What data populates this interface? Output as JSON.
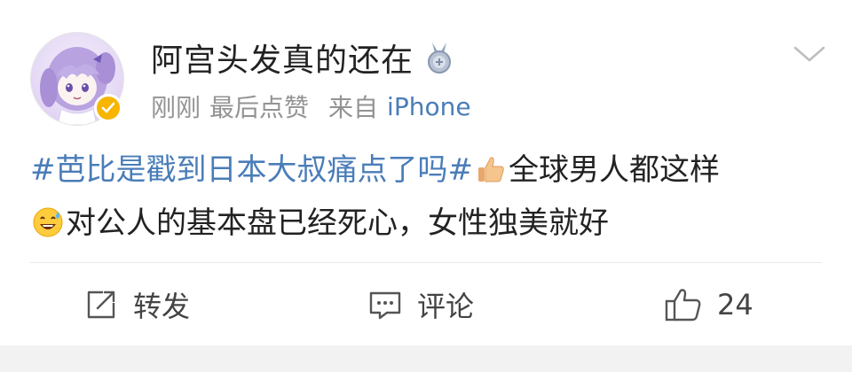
{
  "post": {
    "username": "阿宫头发真的还在",
    "level_badge_icon": "medal-icon",
    "timestamp": "刚刚",
    "activity": "最后点赞",
    "source_prefix": "来自",
    "device": "iPhone",
    "hashtag": "#芭比是戳到日本大叔痛点了吗#",
    "text_part1": "全球男人都这样",
    "text_part2": "对公人的基本盘已经死心，女性独美就好",
    "emoji_1": "thumbs-up-emoji",
    "emoji_2": "sweat-smile-emoji"
  },
  "actions": {
    "repost_label": "转发",
    "comment_label": "评论",
    "like_count": "24"
  },
  "colors": {
    "link": "#4a7db8",
    "meta": "#939393",
    "verified": "#f7b500"
  }
}
